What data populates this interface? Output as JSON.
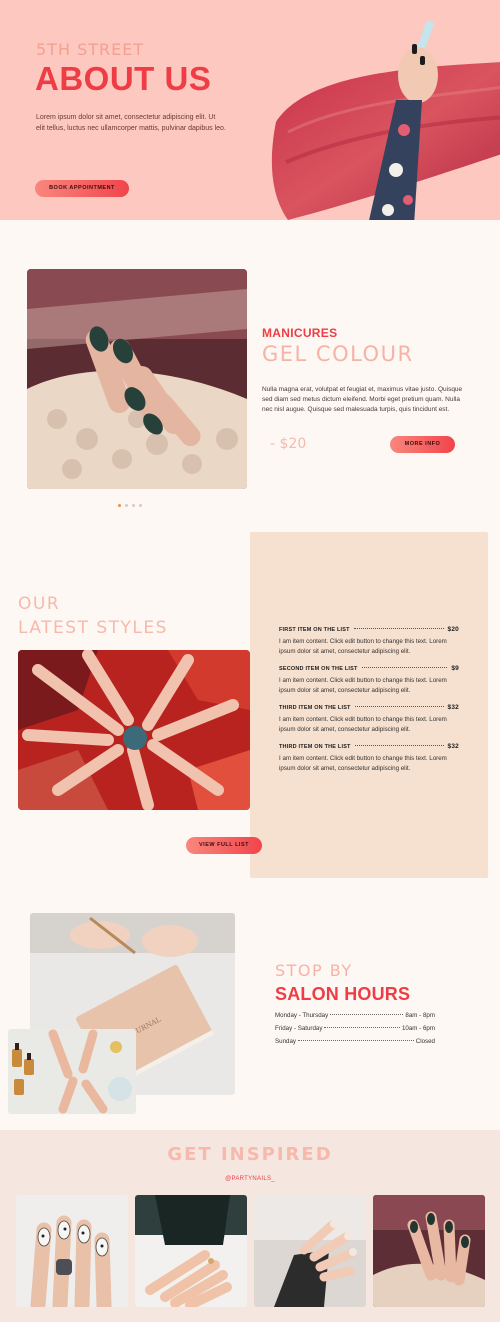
{
  "hero": {
    "kicker": "5TH STREET",
    "title": "ABOUT US",
    "body": "Lorem ipsum dolor sit amet, consectetur adipiscing elit. Ut elit tellus, luctus nec ullamcorper mattis, pulvinar dapibus leo.",
    "button": "BOOK APPOINTMENT"
  },
  "manicures": {
    "kicker": "MANICURES",
    "title": "GEL COLOUR",
    "body": "Nulla magna erat, volutpat et feugiat et, maximus vitae justo. Quisque sed diam sed metus dictum eleifend. Morbi eget pretium quam. Nulla nec nisl augue. Quisque sed malesuada turpis, quis tincidunt est.",
    "price": "- $20",
    "button": "MORE INFO"
  },
  "styles": {
    "line1": "OUR",
    "line2": "LATEST STYLES",
    "button": "VIEW FULL LIST",
    "items": [
      {
        "name": "FIRST ITEM ON THE LIST",
        "price": "$20",
        "desc": "I am item content. Click edit button to change this text. Lorem ipsum dolor sit amet, consectetur adipiscing elit."
      },
      {
        "name": "SECOND ITEM ON THE LIST",
        "price": "$9",
        "desc": "I am item content. Click edit button to change this text. Lorem ipsum dolor sit amet, consectetur adipiscing elit."
      },
      {
        "name": "THIRD ITEM ON THE LIST",
        "price": "$32",
        "desc": "I am item content. Click edit button to change this text. Lorem ipsum dolor sit amet, consectetur adipiscing elit."
      },
      {
        "name": "THIRD ITEM ON THE LIST",
        "price": "$32",
        "desc": "I am item content. Click edit button to change this text. Lorem ipsum dolor sit amet, consectetur adipiscing elit."
      }
    ]
  },
  "hours": {
    "kicker": "STOP BY",
    "title": "SALON HOURS",
    "notebook_text": "JOURNAL",
    "rows": [
      {
        "day": "Monday - Thursday",
        "time": "8am - 8pm"
      },
      {
        "day": "Friday - Saturday",
        "time": "10am - 6pm"
      },
      {
        "day": "Sunday",
        "time": "Closed"
      }
    ]
  },
  "inspired": {
    "title": "GET INSPIRED",
    "handle": "@PARTYNAILS_"
  },
  "colors": {
    "accent": "#ee3d44",
    "hero_bg": "#fcc8c0",
    "light_accent": "#f7b2a6",
    "card_bg": "#f6e0cf",
    "page_bg": "#fdf8f4"
  }
}
